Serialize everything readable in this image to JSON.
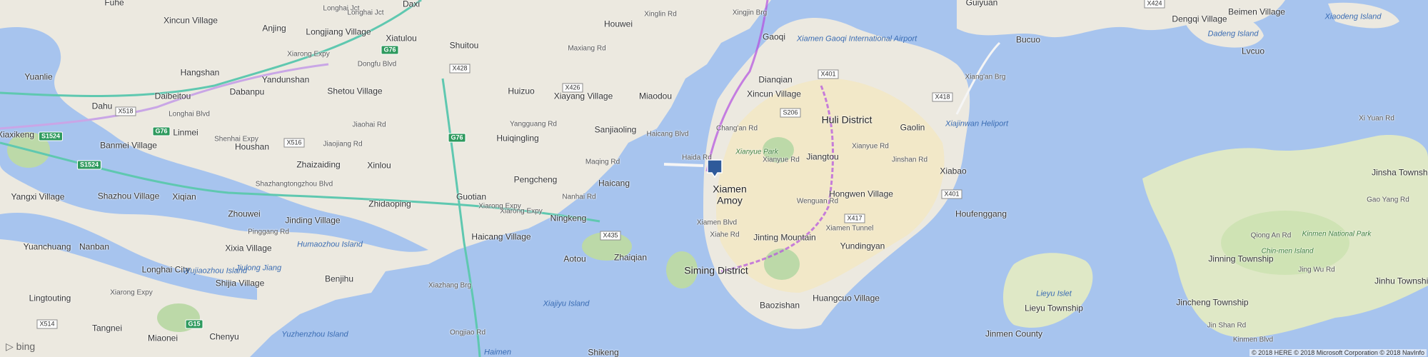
{
  "map": {
    "colors": {
      "water": "#a7c4ee",
      "land": "#ece9e0",
      "park": "#bcd9a8",
      "urban": "#f2e8c8",
      "expressway": "#5fc8b0",
      "route": "#b34fe0",
      "pin": "#2f5a9a"
    },
    "districts": [
      "Huli District",
      "Siming District",
      "Xiamen",
      "Amoy"
    ],
    "places": [
      "Fuhe",
      "Xincun Village",
      "Daxi",
      "Guiyuan",
      "Bucuo",
      "Dengqi Village",
      "Beimen Village",
      "Xiaodeng Island",
      "Dadeng Island",
      "Lvcuo",
      "Anjing",
      "Longjiang Village",
      "Xiatulou",
      "Shuitou",
      "Houwei",
      "Gaoqi",
      "Hangshan",
      "Yuanlie",
      "Yandunshan",
      "Dabanpu",
      "Shetou Village",
      "Huizuo",
      "Xiayang Village",
      "Miaodou",
      "Dianqian",
      "Xincun Village",
      "Gaolin",
      "Dahu",
      "Daibeitou",
      "Huiqingling",
      "Sanjiaoling",
      "Xiaxikeng",
      "Linmei",
      "Banmei Village",
      "Houshan",
      "Zhaizaiding",
      "Xinlou",
      "Jiangtou",
      "Xiabao",
      "Pengcheng",
      "Haicang",
      "Yangxi Village",
      "Shazhou Village",
      "Xiqian",
      "Zhidaoping",
      "Guotian",
      "Hongwen Village",
      "Houfenggang",
      "Zhouwei",
      "Jinding Village",
      "Ningkeng",
      "Yuanchuang",
      "Nanban",
      "Xixia Village",
      "Haicang Village",
      "Jinting Mountain",
      "Yundingyan",
      "Aotou",
      "Zhaiqian",
      "Longhai City",
      "Benjihu",
      "Shijia Village",
      "Lingtouting",
      "Huangcuo Village",
      "Baozishan",
      "Jinsha Township",
      "Jinning Township",
      "Jincheng Township",
      "Jinhu Township",
      "Lieyu Township",
      "Jinmen County",
      "Tangnei",
      "Chenyu",
      "Miaonei",
      "Shikeng",
      "Chin-men Island"
    ],
    "water_labels": [
      "Xiamen Gaoqi International Airport",
      "Xiajinwan Heliport",
      "Humaozhou Island",
      "Wujiaozhou Island",
      "Jiulong Jiang",
      "Xiajiyu Island",
      "Yuzhenzhou Island",
      "Lieyu Islet",
      "Haimen"
    ],
    "park_labels": [
      "Xianyue Park",
      "Kinmen National Park"
    ],
    "roads": [
      "Xingjin Brg",
      "Longhai Jct",
      "Longhai Blvd",
      "Dongfu Blvd",
      "Xiarong Expy",
      "Xiarong Expy",
      "Xiarong Expy",
      "Maxiang Rd",
      "Xinglin Rd",
      "Yangguang Rd",
      "Jiaohai Rd",
      "Longhai Jct",
      "Shenhai Expy",
      "Jiaojiang Rd",
      "Haicang Blvd",
      "Chang'an Rd",
      "Haida Rd",
      "Xianyue Rd",
      "Xianyue Rd",
      "Jinshan Rd",
      "Shazhangtongzhou Blvd",
      "Maqing Rd",
      "Nanhai Rd",
      "Wenguan Rd",
      "Xiahe Rd",
      "Xiamen Tunnel",
      "Xiang'an Brg",
      "Xi Yuan Rd",
      "Gao Yang Rd",
      "Qiong An Rd",
      "Jing Wu Rd",
      "Jin Shan Rd",
      "Pinggang Rd",
      "Xiarong Expy",
      "Xiazhang Brg",
      "Ongjiao Rd",
      "Xiamen Blvd",
      "Kinmen Blvd"
    ],
    "shields": [
      "X428",
      "G76",
      "X426",
      "X518",
      "G76",
      "S1524",
      "S1524",
      "G76",
      "X516",
      "S206",
      "X401",
      "X418",
      "X401",
      "X417",
      "X435",
      "X514",
      "G15",
      "X424"
    ],
    "attribution": {
      "logo": "bing",
      "copyright": "© 2018 HERE © 2018 Microsoft Corporation © 2018 NavInfo"
    }
  }
}
